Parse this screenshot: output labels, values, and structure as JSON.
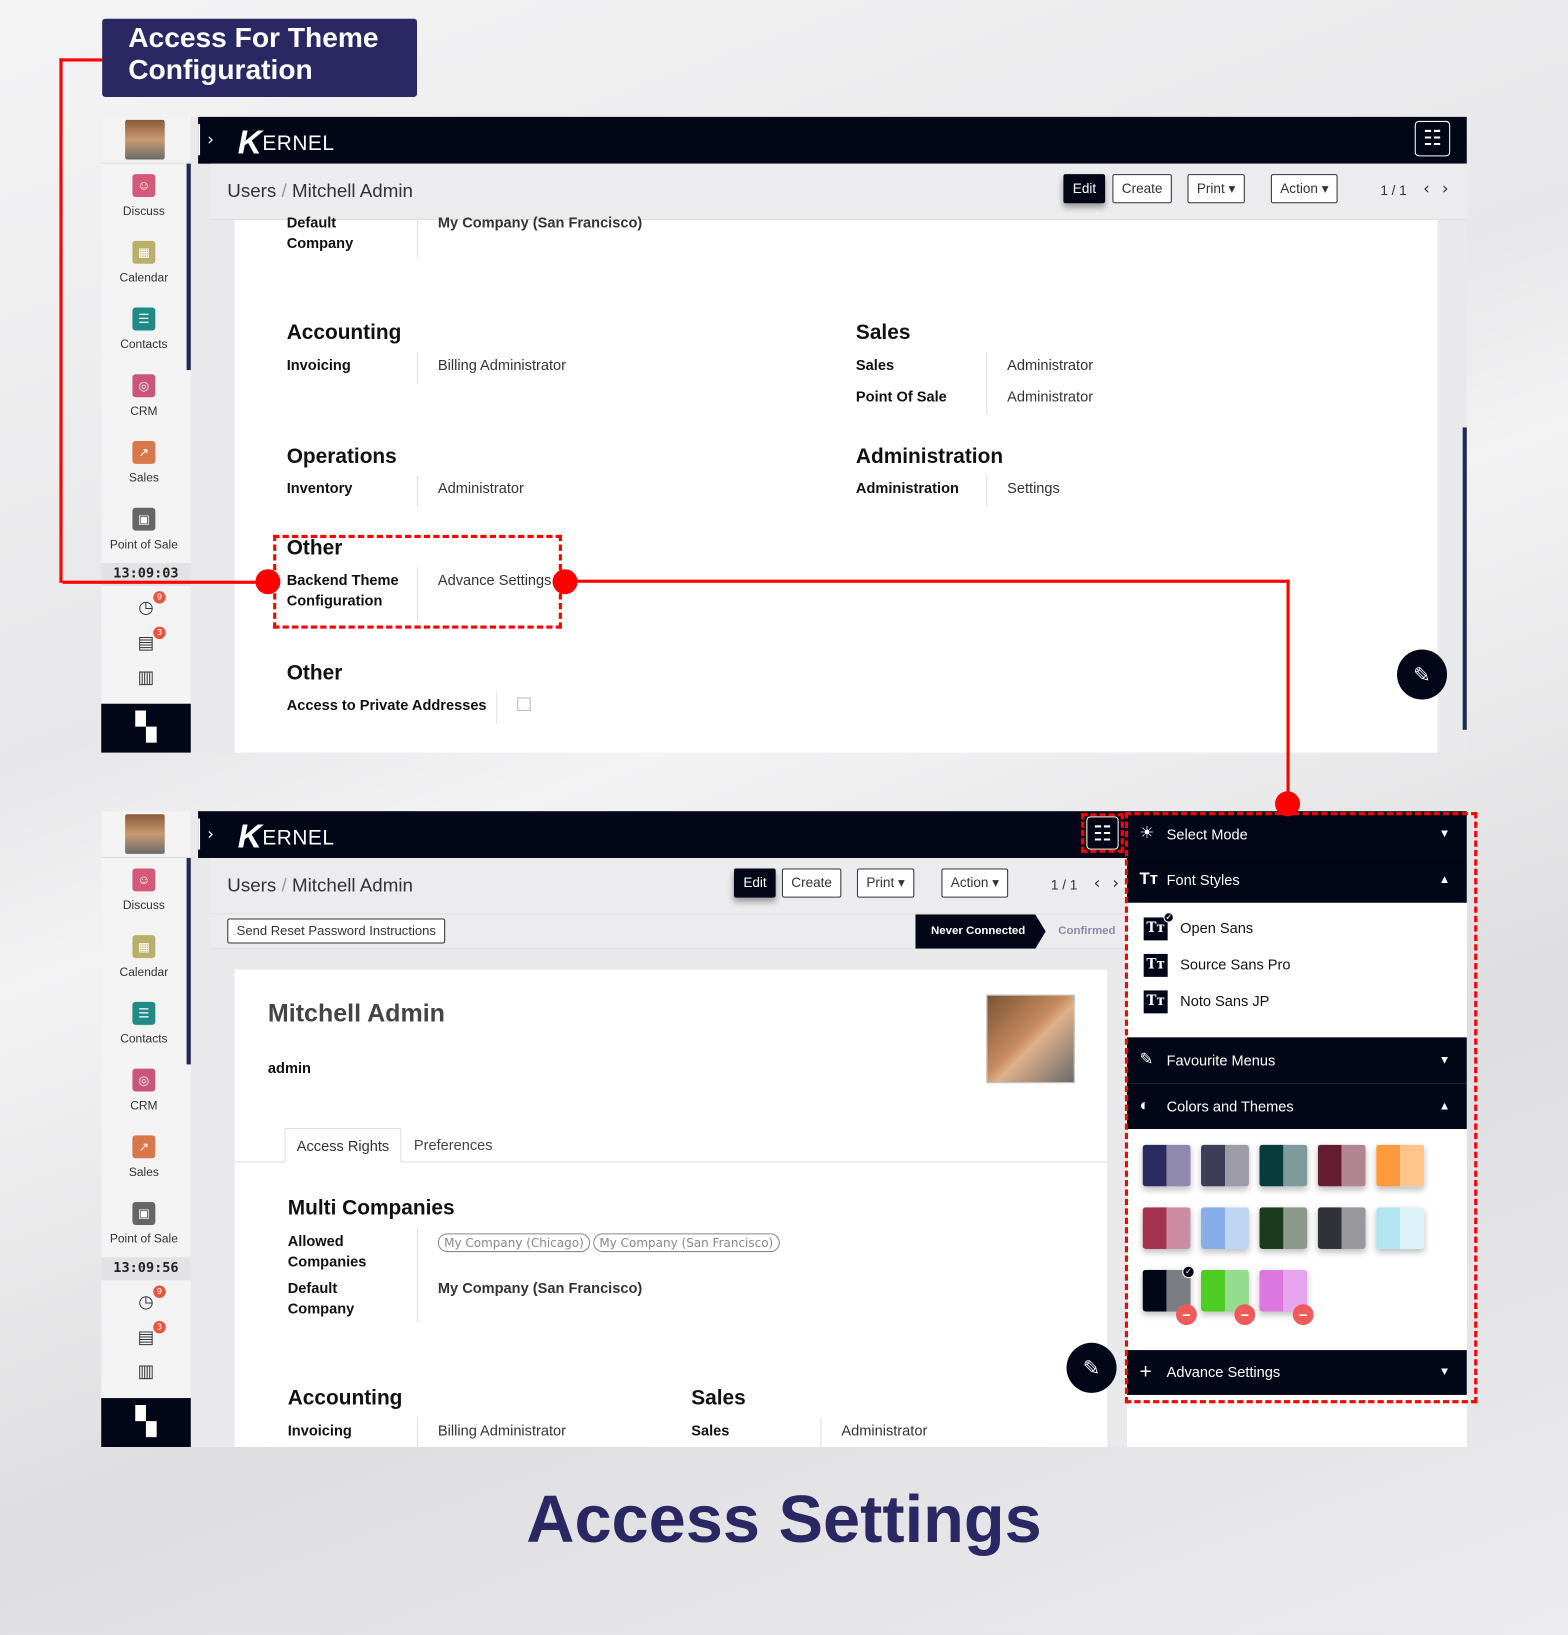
{
  "callout_title": "Access For Theme Configuration",
  "footer_title": "Access Settings",
  "brand": {
    "logo_text": "ERNEL",
    "accent": "#2a2763",
    "highlight": "#ff0000",
    "dark": "#020617"
  },
  "sidebar": {
    "apps": [
      {
        "label": "Discuss",
        "icon": "discuss-icon",
        "color": "#d45a7a"
      },
      {
        "label": "Calendar",
        "icon": "calendar-icon",
        "color": "#b8b06a"
      },
      {
        "label": "Contacts",
        "icon": "contacts-icon",
        "color": "#1f8a86"
      },
      {
        "label": "CRM",
        "icon": "crm-icon",
        "color": "#c9557a"
      },
      {
        "label": "Sales",
        "icon": "sales-icon",
        "color": "#d9774a"
      },
      {
        "label": "Point of Sale",
        "icon": "pos-icon",
        "color": "#666"
      }
    ],
    "activity_badge": "9",
    "messages_badge": "3"
  },
  "screen1": {
    "clock": "13:09:03",
    "breadcrumb": {
      "parent": "Users",
      "current": "Mitchell Admin"
    },
    "buttons": {
      "edit": "Edit",
      "create": "Create",
      "print": "Print",
      "action": "Action"
    },
    "pager": "1 / 1",
    "default_company": {
      "label_1": "Default",
      "label_2": "Company",
      "value": "My Company (San Francisco)"
    },
    "accounting": {
      "title": "Accounting",
      "label": "Invoicing",
      "value": "Billing Administrator"
    },
    "sales": {
      "title": "Sales",
      "rows": [
        {
          "label": "Sales",
          "value": "Administrator"
        },
        {
          "label": "Point Of Sale",
          "value": "Administrator"
        }
      ]
    },
    "operations": {
      "title": "Operations",
      "label": "Inventory",
      "value": "Administrator"
    },
    "administration": {
      "title": "Administration",
      "label": "Administration",
      "value": "Settings"
    },
    "other1": {
      "title": "Other",
      "label_1": "Backend Theme",
      "label_2": "Configuration",
      "value": "Advance Settings"
    },
    "other2": {
      "title": "Other",
      "label": "Access to Private Addresses",
      "checked": false
    }
  },
  "screen2": {
    "clock": "13:09:56",
    "breadcrumb": {
      "parent": "Users",
      "current": "Mitchell Admin"
    },
    "buttons": {
      "edit": "Edit",
      "create": "Create",
      "print": "Print",
      "action": "Action"
    },
    "pager": "1 / 1",
    "reset_button": "Send Reset Password Instructions",
    "status": {
      "active": "Never Connected",
      "next": "Confirmed"
    },
    "user_name": "Mitchell Admin",
    "login": "admin",
    "tabs": [
      "Access Rights",
      "Preferences"
    ],
    "multi_companies": {
      "title": "Multi Companies",
      "allowed_1": "Allowed",
      "allowed_2": "Companies",
      "tags": [
        "My Company (Chicago)",
        "My Company (San Francisco)"
      ],
      "default_1": "Default",
      "default_2": "Company",
      "default_value": "My Company (San Francisco)"
    },
    "accounting": {
      "title": "Accounting",
      "label": "Invoicing",
      "value": "Billing Administrator"
    },
    "sales": {
      "title": "Sales",
      "label": "Sales",
      "value": "Administrator"
    }
  },
  "theme_panel": {
    "select_mode": "Select Mode",
    "font_styles": "Font Styles",
    "fonts": [
      {
        "name": "Open Sans",
        "selected": true
      },
      {
        "name": "Source Sans Pro",
        "selected": false
      },
      {
        "name": "Noto Sans JP",
        "selected": false
      }
    ],
    "favourite_menus": "Favourite Menus",
    "colors_themes": "Colors and Themes",
    "swatches": [
      {
        "primary": "#2c2a5e",
        "secondary": "#9089ad"
      },
      {
        "primary": "#3d3d58",
        "secondary": "#9c9ca8"
      },
      {
        "primary": "#073b3e",
        "secondary": "#7e9a9b"
      },
      {
        "primary": "#661c30",
        "secondary": "#b18692"
      },
      {
        "primary": "#ff9a3c",
        "secondary": "#ffc58a"
      },
      {
        "primary": "#a23250",
        "secondary": "#cd8ca3"
      },
      {
        "primary": "#86aee8",
        "secondary": "#c0d4f3"
      },
      {
        "primary": "#1c3a1c",
        "secondary": "#8a998a"
      },
      {
        "primary": "#313138",
        "secondary": "#97979c"
      },
      {
        "primary": "#b3e5f1",
        "secondary": "#daf2f8"
      },
      {
        "primary": "#020617",
        "secondary": "#7b7d84",
        "selected": true,
        "removable": true
      },
      {
        "primary": "#4fcc22",
        "secondary": "#93dd8e",
        "removable": true
      },
      {
        "primary": "#dd77e0",
        "secondary": "#e8a3ee",
        "removable": true
      }
    ],
    "advance_settings": "Advance Settings"
  }
}
